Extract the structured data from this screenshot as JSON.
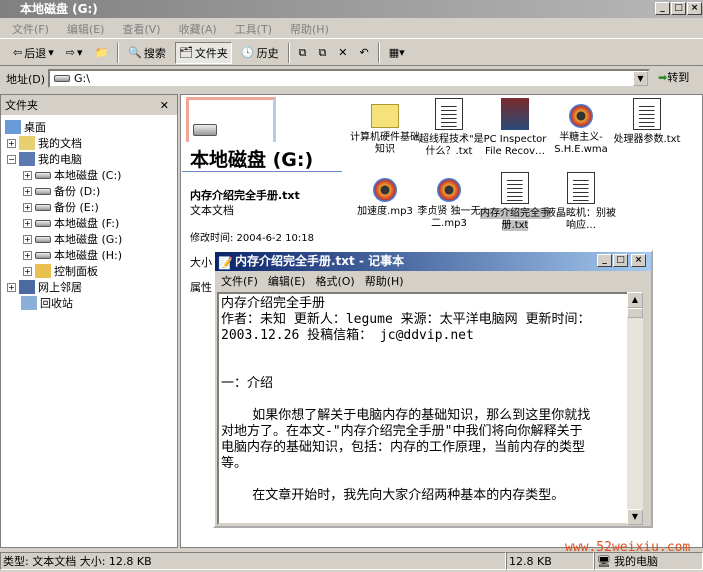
{
  "window": {
    "title": "本地磁盘 (G:)"
  },
  "menu": [
    "文件(F)",
    "编辑(E)",
    "查看(V)",
    "收藏(A)",
    "工具(T)",
    "帮助(H)"
  ],
  "toolbar": {
    "back": "后退",
    "search": "搜索",
    "folders": "文件夹",
    "history": "历史"
  },
  "address": {
    "label": "地址(D)",
    "value": "G:\\",
    "go": "转到"
  },
  "folders_pane": {
    "title": "文件夹",
    "items": [
      "桌面",
      "我的文档",
      "我的电脑",
      "本地磁盘 (C:)",
      "备份 (D:)",
      "备份 (E:)",
      "本地磁盘 (F:)",
      "本地磁盘 (G:)",
      "本地磁盘 (H:)",
      "控制面板",
      "网上邻居",
      "回收站"
    ]
  },
  "details": {
    "drive_title": "本地磁盘 (G:)",
    "file_name": "内存介绍完全手册.txt",
    "file_type": "文本文档",
    "modified": "修改时间: 2004-6-2 10:18",
    "size_label": "大小",
    "attr_label": "属性"
  },
  "files": [
    "计算机硬件基础知识",
    "\"超线程技术\"是什么？.txt",
    "PC Inspector File Recov…",
    "半糖主义-S.H.E.wma",
    "处理器参数.txt",
    "加速度.mp3",
    "李贞贤 独一无二.mp3",
    "内存介绍完全手册.txt",
    "液晶眩机：别被响应…"
  ],
  "notepad": {
    "title": "内存介绍完全手册.txt - 记事本",
    "menu": [
      "文件(F)",
      "编辑(E)",
      "格式(O)",
      "帮助(H)"
    ],
    "lines": [
      "内存介绍完全手册",
      "作者：未知 更新人：legume 来源：太平洋电脑网 更新时间：",
      "2003.12.26 投稿信箱： jc@ddvip.net",
      "",
      "",
      "一：介绍",
      "",
      "    如果你想了解关于电脑内存的基础知识，那么到这里你就找",
      "对地方了。在本文-\"内存介绍完全手册\"中我们将向你解释关于",
      "电脑内存的基础知识，包括：内存的工作原理，当前内存的类型",
      "等。",
      "",
      "    在文章开始时，我先向大家介绍两种基本的内存类型。"
    ]
  },
  "status": {
    "left": "类型: 文本文档 大小: 12.8 KB",
    "size": "12.8 KB",
    "zone": "我的电脑"
  },
  "watermark": "www.52weixiu.com"
}
